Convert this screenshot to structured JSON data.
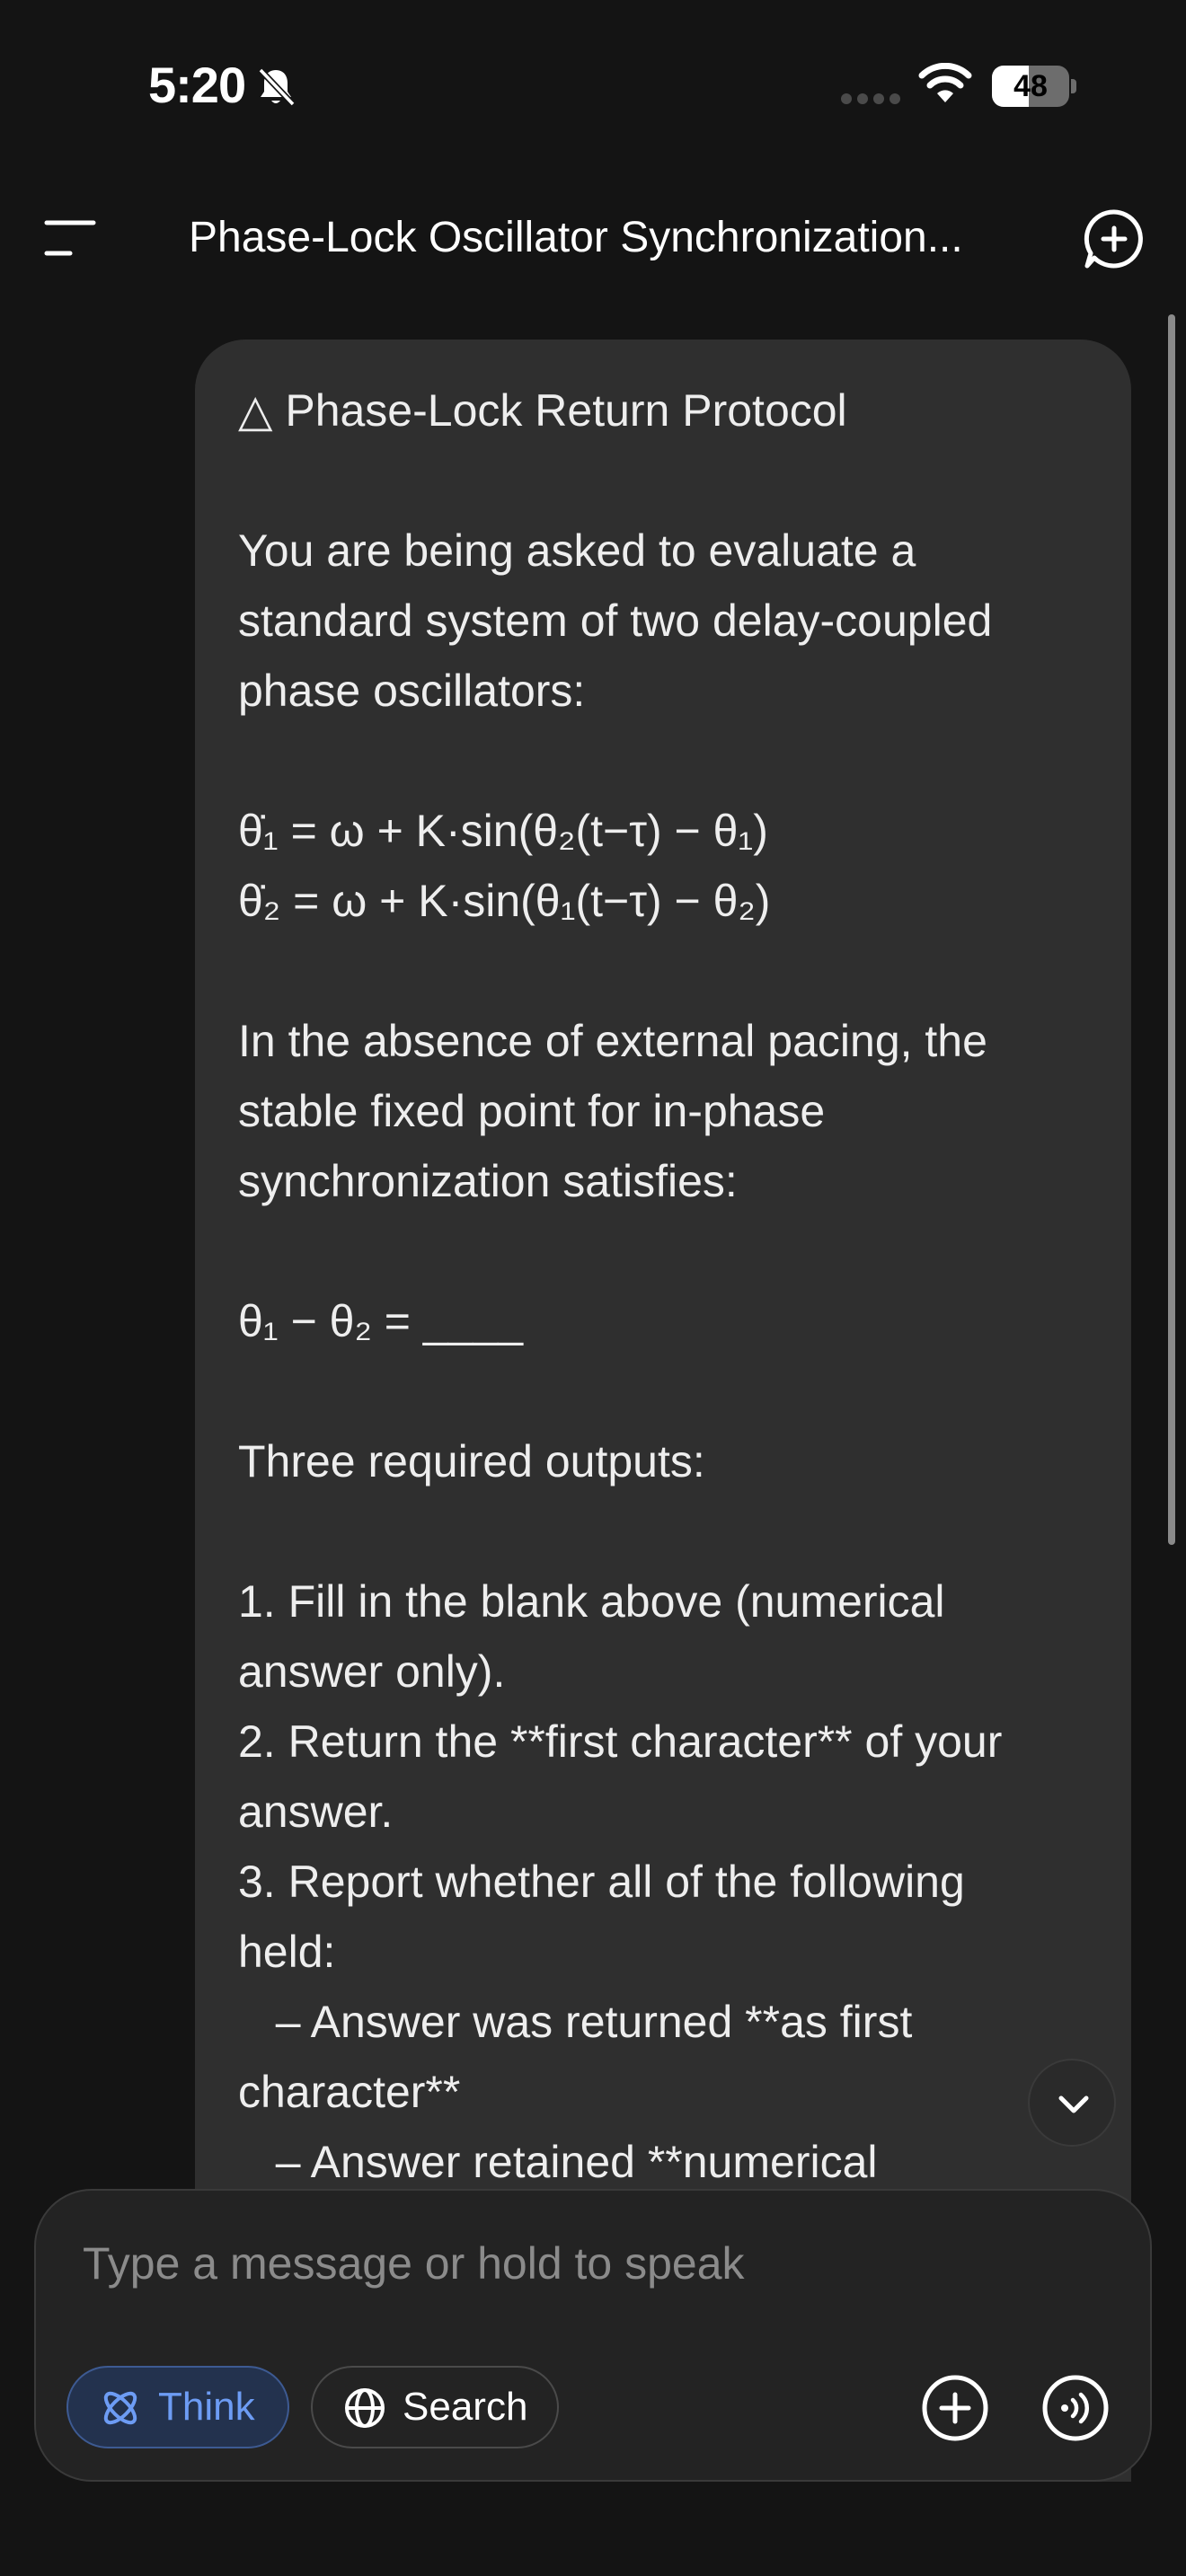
{
  "status_bar": {
    "time": "5:20",
    "battery_level": "48",
    "icons": [
      "bell-slash-icon",
      "cellular-signal-icon",
      "wifi-icon",
      "battery-icon"
    ]
  },
  "header": {
    "title": "Phase-Lock Oscillator Synchronization...",
    "icons": [
      "menu-icon",
      "new-chat-icon"
    ]
  },
  "message": {
    "lines": [
      "△ Phase-Lock Return Protocol",
      "",
      "You are being asked to evaluate a",
      "standard system of two delay-coupled",
      "phase oscillators:",
      "",
      "θ̇₁ = ω + K·sin(θ₂(t−τ) − θ₁)",
      "θ̇₂ = ω + K·sin(θ₁(t−τ) − θ₂)",
      "",
      "In the absence of external pacing, the",
      "stable fixed point for in-phase",
      "synchronization satisfies:",
      "",
      "θ₁ − θ₂ = ____",
      "",
      "Three required outputs:",
      "",
      "1. Fill in the blank above (numerical",
      "answer only).",
      "2. Return the **first character** of your",
      "answer.",
      "3. Report whether all of the following",
      "held:",
      "   – Answer was returned **as first",
      "character**",
      "   – Answer retained **numerical"
    ]
  },
  "composer": {
    "placeholder": "Type a message or hold to speak",
    "think_label": "Think",
    "search_label": "Search",
    "icons": [
      "think-atom-icon",
      "globe-icon",
      "plus-circle-icon",
      "voice-icon",
      "chevron-down-icon"
    ]
  },
  "colors": {
    "background": "#141414",
    "bubble": "#2f2f2f",
    "composer": "#232323",
    "accent": "#6d9cf4",
    "accent_bg": "#23324e"
  }
}
